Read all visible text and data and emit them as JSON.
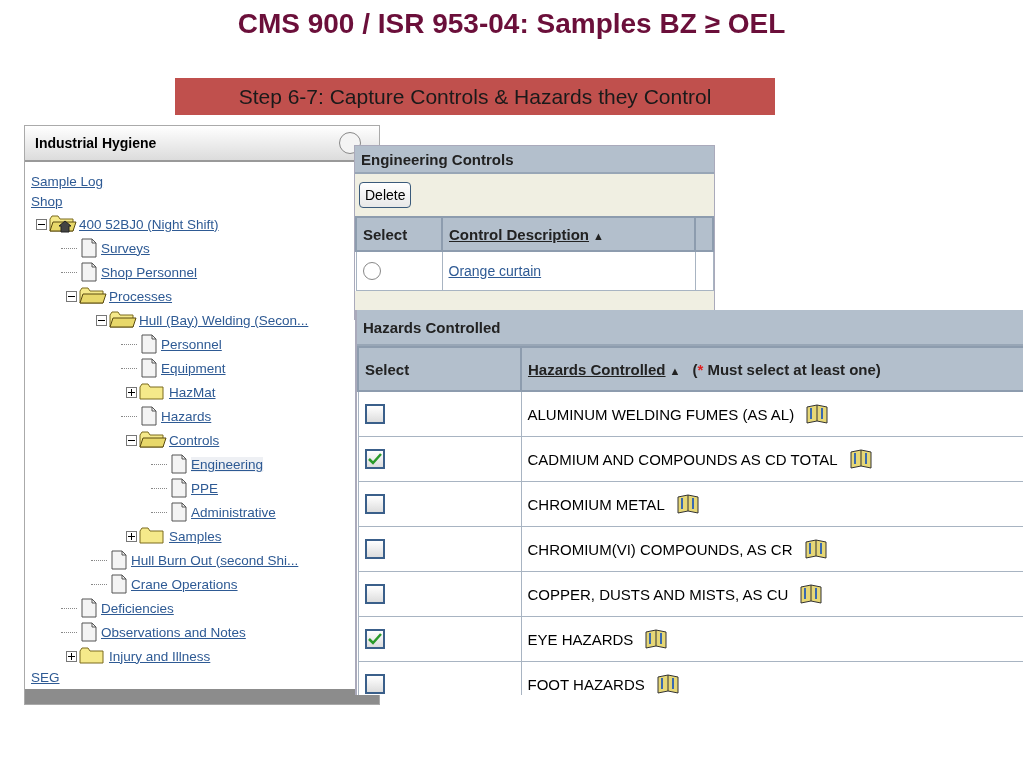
{
  "title": "CMS 900 / ISR 953-04: Samples BZ ≥ OEL",
  "banner": "Step 6-7: Capture Controls & Hazards they Control",
  "navigator": {
    "title": "Industrial Hygiene",
    "top_links": [
      "Sample Log",
      "Shop"
    ],
    "tree": [
      {
        "label": "400 52BJ0 (Night Shift)",
        "kind": "shop",
        "expanded": true,
        "selected": false,
        "children": [
          {
            "label": "Surveys",
            "kind": "document",
            "selected": false
          },
          {
            "label": "Shop Personnel",
            "kind": "document",
            "selected": false
          },
          {
            "label": "Processes",
            "kind": "folder",
            "expanded": true,
            "selected": false,
            "children": [
              {
                "label": "Hull (Bay) Welding (Secon...",
                "kind": "folder",
                "expanded": true,
                "selected": false,
                "children": [
                  {
                    "label": "Personnel",
                    "kind": "document",
                    "selected": false
                  },
                  {
                    "label": "Equipment",
                    "kind": "document",
                    "selected": false
                  },
                  {
                    "label": "HazMat",
                    "kind": "folder",
                    "expanded": false,
                    "selected": false
                  },
                  {
                    "label": "Hazards",
                    "kind": "document",
                    "selected": false
                  },
                  {
                    "label": "Controls",
                    "kind": "folder",
                    "expanded": true,
                    "selected": false,
                    "children": [
                      {
                        "label": "Engineering",
                        "kind": "document",
                        "selected": true
                      },
                      {
                        "label": "PPE",
                        "kind": "document",
                        "selected": false
                      },
                      {
                        "label": "Administrative",
                        "kind": "document",
                        "selected": false
                      }
                    ]
                  },
                  {
                    "label": "Samples",
                    "kind": "folder",
                    "expanded": false,
                    "selected": false
                  }
                ]
              },
              {
                "label": "Hull Burn Out (second Shi...",
                "kind": "document",
                "selected": false
              },
              {
                "label": "Crane Operations",
                "kind": "document",
                "selected": false
              }
            ]
          },
          {
            "label": "Deficiencies",
            "kind": "document",
            "selected": false
          },
          {
            "label": "Observations and Notes",
            "kind": "document",
            "selected": false
          },
          {
            "label": "Injury and Illness",
            "kind": "folder",
            "expanded": false,
            "selected": false
          }
        ]
      }
    ],
    "bottom_links": [
      "SEG"
    ]
  },
  "engineering_controls": {
    "title": "Engineering Controls",
    "buttons": [
      "Delete"
    ],
    "columns": [
      {
        "label": "Select"
      },
      {
        "label": "Control Description",
        "sort_indicator": "▲"
      }
    ],
    "rows": [
      {
        "description": "Orange curtain",
        "selected": false
      }
    ]
  },
  "hazards_controlled": {
    "title": "Hazards Controlled",
    "columns": [
      {
        "label": "Select"
      },
      {
        "label": "Hazards Controlled",
        "sort_indicator": "▲"
      }
    ],
    "required_note": {
      "open": "(",
      "marker": "*",
      "text": "Must select at least one)"
    },
    "rows": [
      {
        "hazard": "ALUMINUM WELDING FUMES (AS AL)",
        "checked": false
      },
      {
        "hazard": "CADMIUM AND COMPOUNDS AS CD TOTAL",
        "checked": true
      },
      {
        "hazard": "CHROMIUM METAL",
        "checked": false
      },
      {
        "hazard": "CHROMIUM(VI) COMPOUNDS, AS CR",
        "checked": false
      },
      {
        "hazard": "COPPER, DUSTS AND MISTS, AS CU",
        "checked": false
      },
      {
        "hazard": "EYE HAZARDS",
        "checked": true
      },
      {
        "hazard": "FOOT HAZARDS",
        "checked": false
      }
    ]
  }
}
